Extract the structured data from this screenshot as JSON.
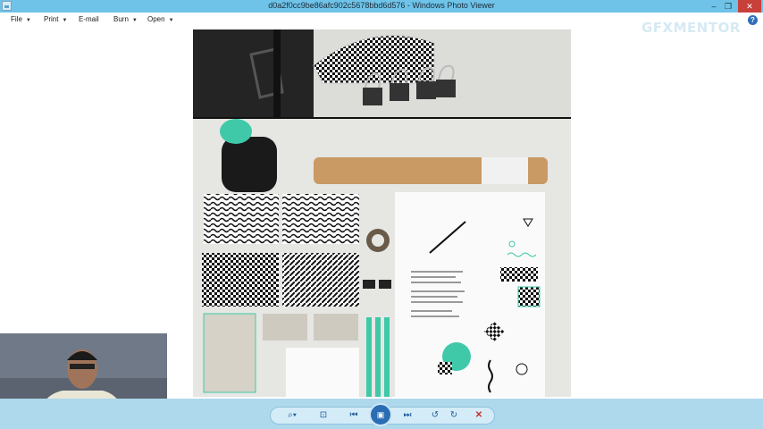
{
  "window": {
    "title": "d0a2f0cc9be86afc902c5678bbd6d576 - Windows Photo Viewer",
    "minimize_glyph": "–",
    "maximize_glyph": "❐",
    "close_glyph": "✕"
  },
  "menu": {
    "items": [
      {
        "label": "File",
        "has_arrow": true
      },
      {
        "label": "Print",
        "has_arrow": true
      },
      {
        "label": "E-mail",
        "has_arrow": false
      },
      {
        "label": "Burn",
        "has_arrow": true
      },
      {
        "label": "Open",
        "has_arrow": true
      }
    ],
    "arrow_glyph": "▼",
    "help_glyph": "?"
  },
  "watermark": "GFXMENTOR",
  "toolbar": {
    "zoom_glyph": "⌕▾",
    "fit_glyph": "⊡",
    "prev_glyph": "⏮",
    "slideshow_glyph": "▣",
    "next_glyph": "⏭",
    "rotate_left_glyph": "↺",
    "rotate_right_glyph": "↻",
    "delete_glyph": "✕"
  },
  "photo": {
    "description_icon": "branding-mockup-image",
    "accent_color": "#3fc9a8"
  },
  "colors": {
    "titlebar": "#6fc3e8",
    "toolbar": "#aed8ec",
    "close": "#c7403a"
  }
}
